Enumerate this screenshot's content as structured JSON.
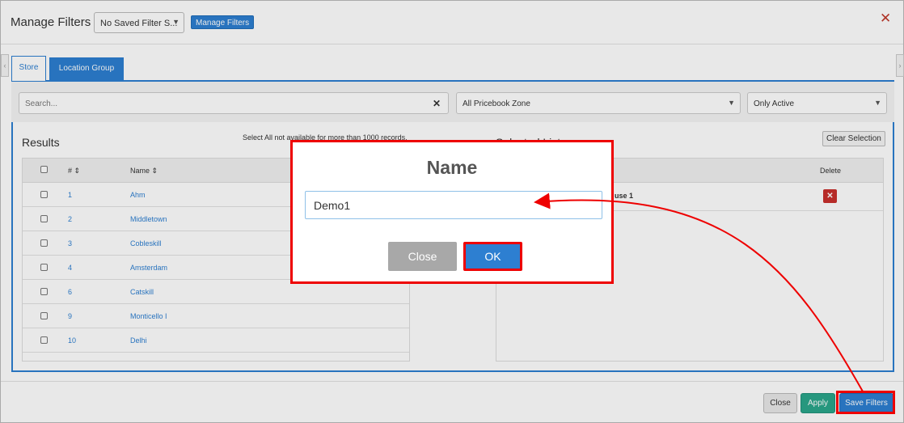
{
  "header": {
    "title": "Manage Filters",
    "saved_filter_select": "No Saved Filter S...",
    "manage_filters_button": "Manage Filters",
    "close": "✕"
  },
  "tabs": [
    {
      "label": "Store"
    },
    {
      "label": "Location Group"
    }
  ],
  "filters": {
    "search_placeholder": "Search...",
    "zone_select": "All Pricebook Zone",
    "status_select": "Only Active"
  },
  "results": {
    "title": "Results",
    "note": "Select All not available for more than 1000 records.",
    "columns": [
      "#",
      "Name"
    ],
    "rows": [
      {
        "num": "1",
        "name": "Ahm"
      },
      {
        "num": "2",
        "name": "Middletown"
      },
      {
        "num": "3",
        "name": "Cobleskill"
      },
      {
        "num": "4",
        "name": "Amsterdam"
      },
      {
        "num": "6",
        "name": "Catskill"
      },
      {
        "num": "9",
        "name": "Monticello I"
      },
      {
        "num": "10",
        "name": "Delhi"
      }
    ]
  },
  "selected": {
    "title": "Selected List",
    "clear_button": "Clear Selection",
    "delete_col": "Delete",
    "row_value": "use 1"
  },
  "footer": {
    "close": "Close",
    "apply": "Apply",
    "save": "Save Filters"
  },
  "modal": {
    "title": "Name",
    "input_value": "Demo1",
    "close": "Close",
    "ok": "OK"
  },
  "colors": {
    "primary": "#2d7fd1",
    "apply": "#2aa68b",
    "highlight": "#ee0000"
  }
}
